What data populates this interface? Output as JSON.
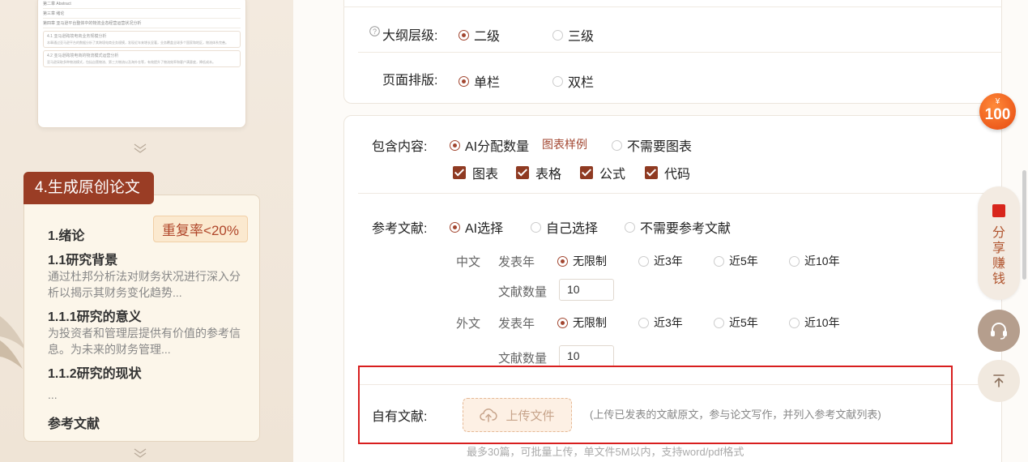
{
  "left": {
    "preview": {
      "line1": "第二章  Abstract",
      "line2": "第三章  绪论",
      "line3": "第四章  亚马逊平台整体中的物流业态经营运营状况分析",
      "sub1": "4.1  亚马逊跨境电商业务规模分析",
      "para1": "本章通过亚马逊平台的数据分析了其跨境电商业务规模，发现近年来增长显著，业务覆盖全球多个国家和地区，物流体系完善。",
      "sub2": "4.2  亚马逊跨境电商的物流模式运营分析",
      "para2": "亚马逊采取多种物流模式，包括自营物流、第三方物流以及海外仓等，有效提升了物流效率和客户满意度，降低成本。"
    },
    "step_title": "4.生成原创论文",
    "dup_badge": "重复率<20%",
    "outline": {
      "h1": "1.绪论",
      "h2": "1.1研究背景",
      "p1": "通过杜邦分析法对财务状况进行深入分析以揭示其财务变化趋势...",
      "h3": "1.1.1研究的意义",
      "p2": "为投资者和管理层提供有价值的参考信息。为未来的财务管理...",
      "h4": "1.1.2研究的现状",
      "ellipsis": "...",
      "h5": "参考文献"
    }
  },
  "form": {
    "outline_level": {
      "label": "大纲层级:",
      "options": [
        "二级",
        "三级"
      ],
      "selected": "二级"
    },
    "layout": {
      "label": "页面排版:",
      "options": [
        "单栏",
        "双栏"
      ],
      "selected": "单栏"
    },
    "include": {
      "label": "包含内容:",
      "options": [
        "AI分配数量",
        "不需要图表"
      ],
      "selected": "AI分配数量",
      "sample_link": "图表样例",
      "checks": [
        "图表",
        "表格",
        "公式",
        "代码"
      ]
    },
    "references": {
      "label": "参考文献:",
      "options": [
        "AI选择",
        "自己选择",
        "不需要参考文献"
      ],
      "selected": "AI选择",
      "chinese": {
        "label": "中文",
        "year_label": "发表年",
        "years": [
          "无限制",
          "近3年",
          "近5年",
          "近10年"
        ],
        "selected": "无限制",
        "count_label": "文献数量",
        "count": "10"
      },
      "foreign": {
        "label": "外文",
        "year_label": "发表年",
        "years": [
          "无限制",
          "近3年",
          "近5年",
          "近10年"
        ],
        "selected": "无限制",
        "count_label": "文献数量",
        "count": "10"
      }
    },
    "own_refs": {
      "label": "自有文献:",
      "upload_label": "上传文件",
      "hint": "(上传已发表的文献原文，参与论文写作，并列入参考文献列表)",
      "limit": "最多30篇，可批量上传，单文件5M以内，支持word/pdf格式"
    }
  },
  "float": {
    "coupon_currency": "¥",
    "coupon_value": "100",
    "share_chars": [
      "分",
      "享",
      "赚",
      "钱"
    ]
  }
}
